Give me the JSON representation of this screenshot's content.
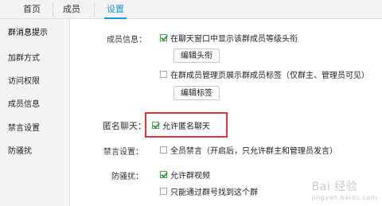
{
  "top_tabs": [
    {
      "label": "首页"
    },
    {
      "label": "成员"
    },
    {
      "label": "设置"
    }
  ],
  "sidebar": {
    "items": [
      {
        "label": "群消息提示"
      },
      {
        "label": "加群方式"
      },
      {
        "label": "访问权限"
      },
      {
        "label": "成员信息"
      },
      {
        "label": "禁言设置"
      },
      {
        "label": "防骚扰"
      }
    ]
  },
  "member_info": {
    "label": "成员信息：",
    "show_rank_in_chat": {
      "label": "在聊天窗口中显示该群成员等级头衔",
      "checked": true
    },
    "edit_title_button": "编辑头衔",
    "show_tag_in_manage": {
      "label": "在群成员管理页展示群成员标签（仅群主、管理员可见）",
      "checked": false
    },
    "edit_tag_button": "编辑标签"
  },
  "anonymous_chat": {
    "label": "匿名聊天：",
    "allow": {
      "label": "允许匿名聊天",
      "checked": true
    }
  },
  "mute_settings": {
    "label": "禁言设置：",
    "mute_all": {
      "label": "全员禁言（开启后，只允许群主和管理员发言）",
      "checked": false
    }
  },
  "anti_harass": {
    "label": "防骚扰：",
    "allow_video": {
      "label": "允许群视频",
      "checked": true
    },
    "find_by_number_only": {
      "label": "只能通过群号找到这个群",
      "checked": false
    }
  },
  "watermark": {
    "text": "Bai 经验",
    "brand": "jingyan.baidu.com"
  }
}
